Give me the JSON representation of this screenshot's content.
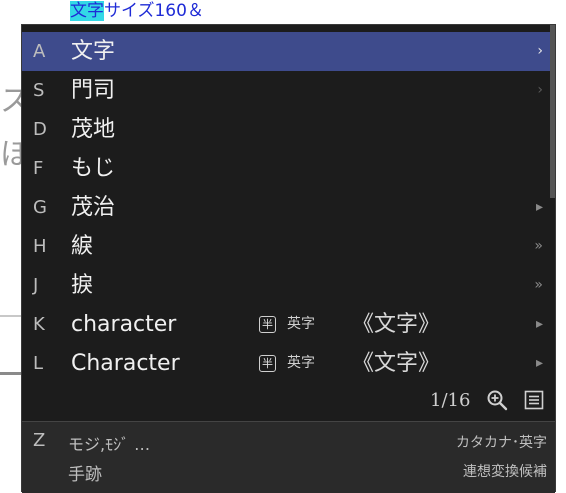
{
  "document": {
    "composition_highlight": "文字",
    "composition_rest": "サイズ160＆",
    "left_fragments": [
      "ス",
      "ほ"
    ]
  },
  "popup": {
    "candidates": [
      {
        "key": "A",
        "text": "文字",
        "badge": "",
        "category": "",
        "reference": "",
        "arrow": "›",
        "selected": true
      },
      {
        "key": "S",
        "text": "門司",
        "badge": "",
        "category": "",
        "reference": "",
        "arrow": "›"
      },
      {
        "key": "D",
        "text": "茂地",
        "badge": "",
        "category": "",
        "reference": "",
        "arrow": ""
      },
      {
        "key": "F",
        "text": "もじ",
        "badge": "",
        "category": "",
        "reference": "",
        "arrow": ""
      },
      {
        "key": "G",
        "text": "茂治",
        "badge": "",
        "category": "",
        "reference": "",
        "arrow": "▸"
      },
      {
        "key": "H",
        "text": "綟",
        "badge": "",
        "category": "",
        "reference": "",
        "arrow": "»"
      },
      {
        "key": "J",
        "text": "捩",
        "badge": "",
        "category": "",
        "reference": "",
        "arrow": "»"
      },
      {
        "key": "K",
        "text": "character",
        "badge": "半",
        "category": "英字",
        "reference": "《文字》",
        "arrow": "▸"
      },
      {
        "key": "L",
        "text": "Character",
        "badge": "半",
        "category": "英字",
        "reference": "《文字》",
        "arrow": "▸"
      }
    ],
    "page_counter": "1/16",
    "icons": {
      "zoom": "zoom-in-icon",
      "list": "list-icon"
    },
    "sub_panel": {
      "key": "Z",
      "reading": "モジ,ﾓｼﾞ …",
      "note": "手跡",
      "label_type": "カタカナ･英字",
      "label_assoc": "連想変換候補"
    },
    "colors": {
      "selected_bg": "#3e4b8c",
      "popup_bg": "#1c1c1c",
      "highlight": "#33d8e6",
      "doc_text": "#1f2bd6"
    }
  }
}
